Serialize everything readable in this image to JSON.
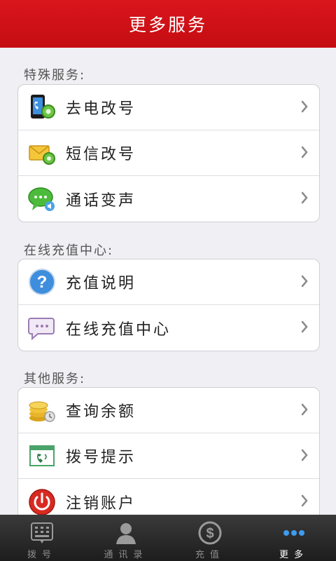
{
  "header": {
    "title": "更多服务"
  },
  "sections": [
    {
      "title": "特殊服务:",
      "items": [
        {
          "label": "去电改号",
          "icon": "phone-settings-icon"
        },
        {
          "label": "短信改号",
          "icon": "envelope-settings-icon"
        },
        {
          "label": "通话变声",
          "icon": "chat-voice-icon"
        }
      ]
    },
    {
      "title": "在线充值中心:",
      "items": [
        {
          "label": "充值说明",
          "icon": "help-icon"
        },
        {
          "label": "在线充值中心",
          "icon": "message-bubble-icon"
        }
      ]
    },
    {
      "title": "其他服务:",
      "items": [
        {
          "label": "查询余额",
          "icon": "coins-icon"
        },
        {
          "label": "拨号提示",
          "icon": "dial-tips-icon"
        },
        {
          "label": "注销账户",
          "icon": "power-icon"
        }
      ]
    }
  ],
  "tabs": [
    {
      "label": "拨号",
      "icon": "dialpad-icon",
      "active": false
    },
    {
      "label": "通讯录",
      "icon": "contacts-icon",
      "active": false
    },
    {
      "label": "充值",
      "icon": "recharge-icon",
      "active": false
    },
    {
      "label": "更多",
      "icon": "more-icon",
      "active": true
    }
  ],
  "colors": {
    "header": "#c40d12",
    "background": "#efeff4",
    "tabbar": "#2a2a2a"
  }
}
